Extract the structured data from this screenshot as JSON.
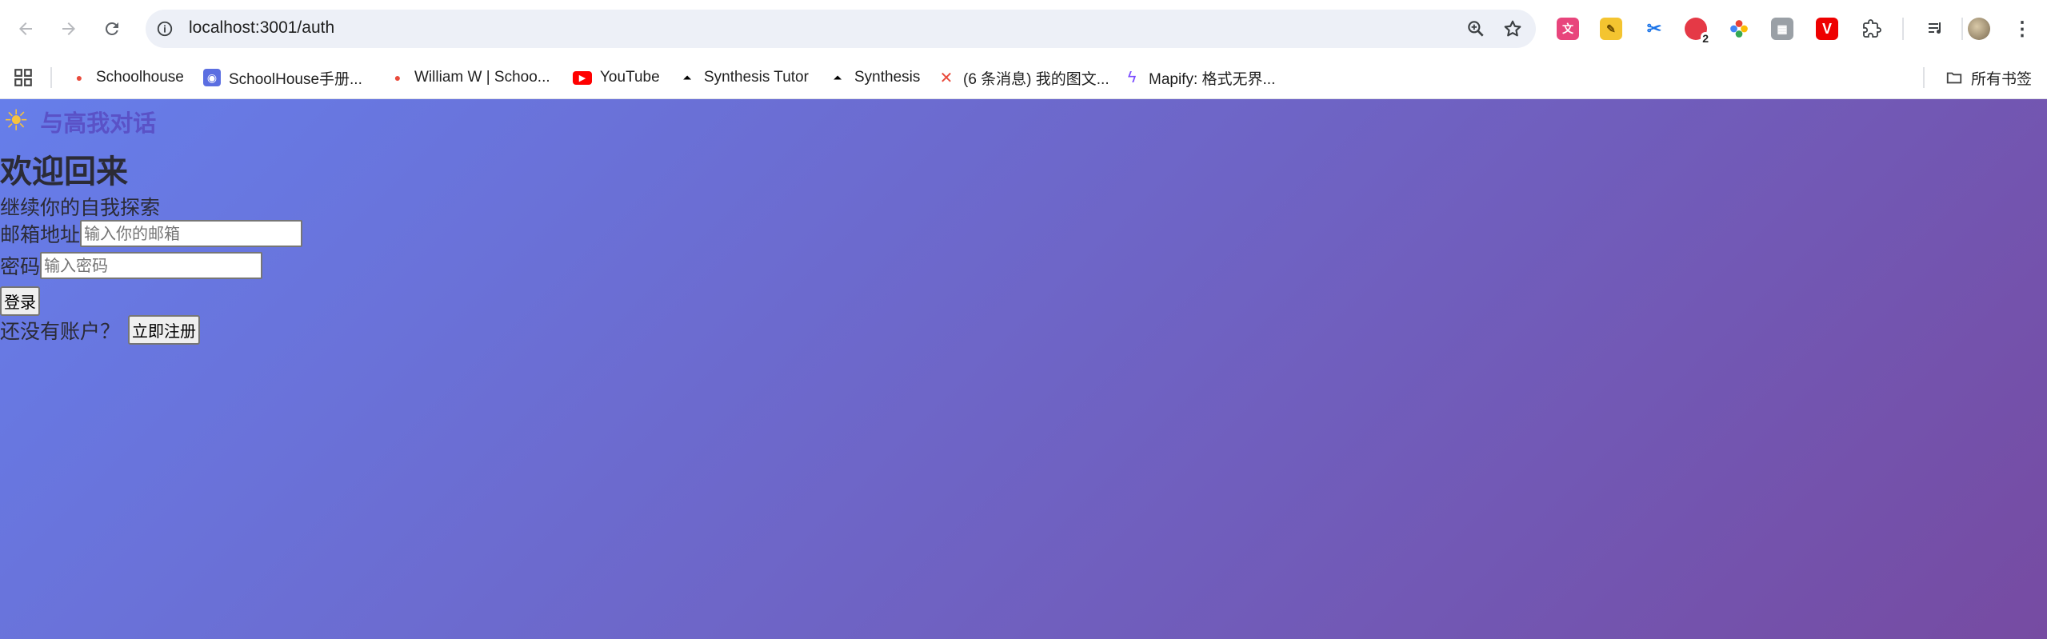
{
  "browser": {
    "url": "localhost:3001/auth",
    "bookmarks": [
      {
        "label": "Schoolhouse",
        "icon": "schoolhouse-icon"
      },
      {
        "label": "SchoolHouse手册...",
        "icon": "schoolhouse-handbook-icon"
      },
      {
        "label": "William W | Schoo...",
        "icon": "schoolhouse-icon"
      },
      {
        "label": "YouTube",
        "icon": "youtube-icon"
      },
      {
        "label": "Synthesis Tutor",
        "icon": "synthesis-icon"
      },
      {
        "label": "Synthesis",
        "icon": "synthesis-icon"
      },
      {
        "label": "(6 条消息) 我的图文...",
        "icon": "csdn-icon"
      },
      {
        "label": "Mapify: 格式无界...",
        "icon": "mapify-icon"
      }
    ],
    "all_bookmarks_label": "所有书签",
    "extension_badge": "2"
  },
  "app": {
    "brand_icon": "sun-icon",
    "brand_name": "与高我对话",
    "title": "欢迎回来",
    "subtitle": "继续你的自我探索",
    "email_label": "邮箱地址",
    "email_placeholder": "输入你的邮箱",
    "password_label": "密码",
    "password_placeholder": "输入密码",
    "login_button": "登录",
    "no_account_text": "还没有账户？",
    "register_button": "立即注册"
  },
  "colors": {
    "gradient_start": "#667eea",
    "gradient_end": "#764ba2",
    "brand_text": "#5a52c7"
  }
}
